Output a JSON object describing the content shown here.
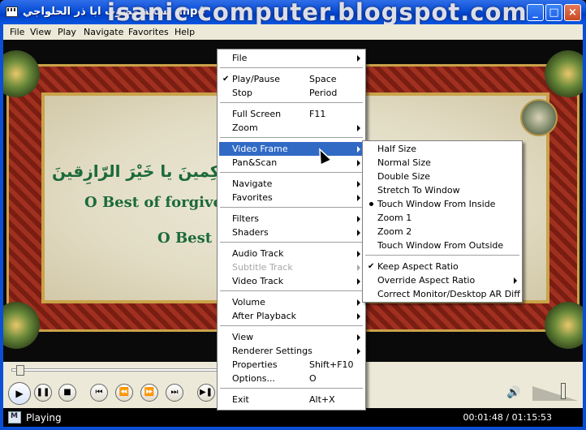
{
  "window": {
    "title": "نسخة مصوت ابا ذر الحلواجي .mp4",
    "watermark": "isanic computer.blogspot.com"
  },
  "menubar": [
    "File",
    "View",
    "Play",
    "Navigate",
    "Favorites",
    "Help"
  ],
  "video": {
    "arabic_line": "يا خَيْرَ الحاكِمينَ يا خَيْرَ الرّازِقينَ",
    "english_line1": "O Best of forgiver",
    "english_line2": "O Best o"
  },
  "context_menu": {
    "items": [
      {
        "label": "File",
        "submenu": true
      },
      {
        "sep": true
      },
      {
        "label": "Play/Pause",
        "accel": "Space",
        "checked": true
      },
      {
        "label": "Stop",
        "accel": "Period"
      },
      {
        "sep": true
      },
      {
        "label": "Full Screen",
        "accel": "F11"
      },
      {
        "label": "Zoom",
        "submenu": true
      },
      {
        "sep": true
      },
      {
        "label": "Video Frame",
        "submenu": true,
        "selected": true
      },
      {
        "label": "Pan&Scan",
        "submenu": true
      },
      {
        "sep": true
      },
      {
        "label": "Navigate",
        "submenu": true
      },
      {
        "label": "Favorites",
        "submenu": true
      },
      {
        "sep": true
      },
      {
        "label": "Filters",
        "submenu": true
      },
      {
        "label": "Shaders",
        "submenu": true
      },
      {
        "sep": true
      },
      {
        "label": "Audio Track",
        "submenu": true
      },
      {
        "label": "Subtitle Track",
        "submenu": true,
        "disabled": true
      },
      {
        "label": "Video Track",
        "submenu": true
      },
      {
        "sep": true
      },
      {
        "label": "Volume",
        "submenu": true
      },
      {
        "label": "After Playback",
        "submenu": true
      },
      {
        "sep": true
      },
      {
        "label": "View",
        "submenu": true
      },
      {
        "label": "Renderer Settings",
        "submenu": true
      },
      {
        "label": "Properties",
        "accel": "Shift+F10"
      },
      {
        "label": "Options...",
        "accel": "O"
      },
      {
        "sep": true
      },
      {
        "label": "Exit",
        "accel": "Alt+X"
      }
    ]
  },
  "video_frame_submenu": {
    "items": [
      {
        "label": "Half Size"
      },
      {
        "label": "Normal Size"
      },
      {
        "label": "Double Size"
      },
      {
        "label": "Stretch To Window"
      },
      {
        "label": "Touch Window From Inside",
        "radio": true
      },
      {
        "label": "Zoom 1"
      },
      {
        "label": "Zoom 2"
      },
      {
        "label": "Touch Window From Outside"
      },
      {
        "sep": true
      },
      {
        "label": "Keep Aspect Ratio",
        "checked": true
      },
      {
        "label": "Override Aspect Ratio",
        "submenu": true
      },
      {
        "label": "Correct Monitor/Desktop AR Diff"
      }
    ]
  },
  "status": {
    "state": "Playing",
    "time": "00:01:48 / 01:15:53",
    "seek_fraction": 0.024,
    "volume_fraction": 0.62
  },
  "toolbar_icons": [
    "play-icon",
    "pause-icon",
    "stop-icon",
    "skip-back-icon",
    "rewind-icon",
    "fast-forward-icon",
    "skip-forward-icon",
    "frame-step-icon"
  ]
}
